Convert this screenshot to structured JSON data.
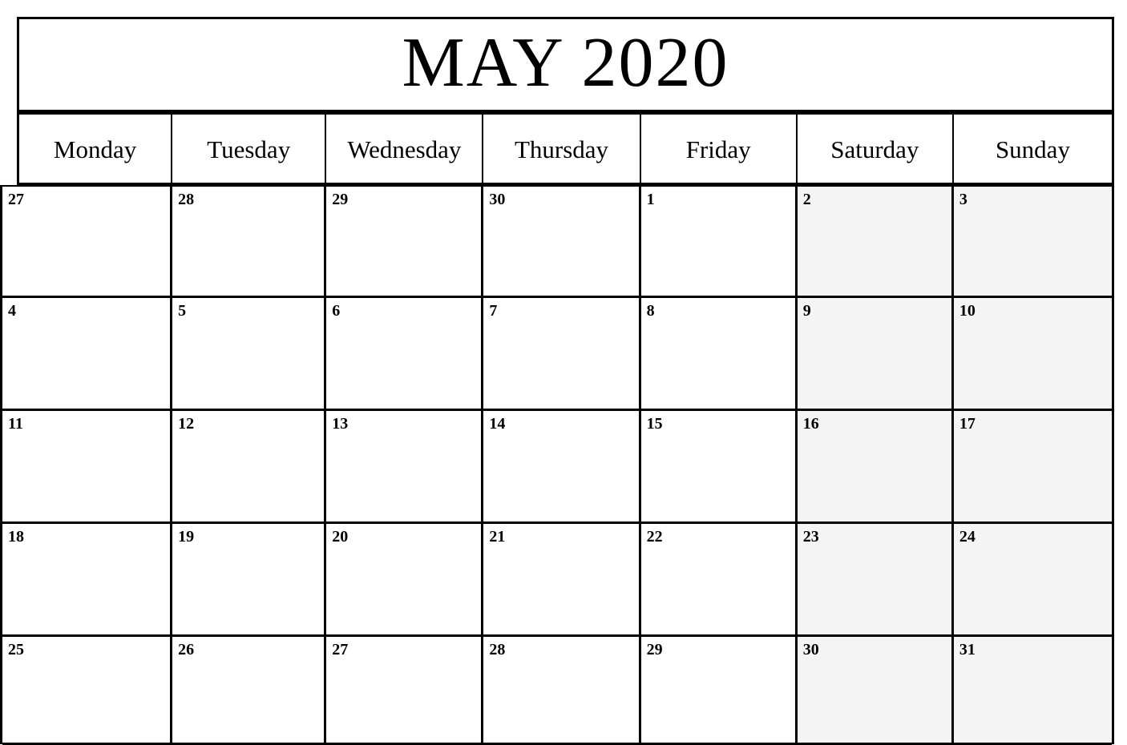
{
  "calendar": {
    "title": "MAY 2020",
    "month": "MAY",
    "year": "2020",
    "colors": {
      "border": "#000000",
      "page_background": "#ffffff",
      "cell_background": "#ffffff",
      "weekend_background": "#f4f4f4",
      "text": "#000000"
    },
    "weekdays": [
      {
        "label": "Monday",
        "weekend": false
      },
      {
        "label": "Tuesday",
        "weekend": false
      },
      {
        "label": "Wednesday",
        "weekend": false
      },
      {
        "label": "Thursday",
        "weekend": false
      },
      {
        "label": "Friday",
        "weekend": false
      },
      {
        "label": "Saturday",
        "weekend": true
      },
      {
        "label": "Sunday",
        "weekend": true
      }
    ],
    "weeks": [
      {
        "days": [
          {
            "number": "27",
            "weekend": false,
            "other_month": true
          },
          {
            "number": "28",
            "weekend": false,
            "other_month": true
          },
          {
            "number": "29",
            "weekend": false,
            "other_month": true
          },
          {
            "number": "30",
            "weekend": false,
            "other_month": true
          },
          {
            "number": "1",
            "weekend": false,
            "other_month": false
          },
          {
            "number": "2",
            "weekend": true,
            "other_month": false
          },
          {
            "number": "3",
            "weekend": true,
            "other_month": false
          }
        ]
      },
      {
        "days": [
          {
            "number": "4",
            "weekend": false,
            "other_month": false
          },
          {
            "number": "5",
            "weekend": false,
            "other_month": false
          },
          {
            "number": "6",
            "weekend": false,
            "other_month": false
          },
          {
            "number": "7",
            "weekend": false,
            "other_month": false
          },
          {
            "number": "8",
            "weekend": false,
            "other_month": false
          },
          {
            "number": "9",
            "weekend": true,
            "other_month": false
          },
          {
            "number": "10",
            "weekend": true,
            "other_month": false
          }
        ]
      },
      {
        "days": [
          {
            "number": "11",
            "weekend": false,
            "other_month": false
          },
          {
            "number": "12",
            "weekend": false,
            "other_month": false
          },
          {
            "number": "13",
            "weekend": false,
            "other_month": false
          },
          {
            "number": "14",
            "weekend": false,
            "other_month": false
          },
          {
            "number": "15",
            "weekend": false,
            "other_month": false
          },
          {
            "number": "16",
            "weekend": true,
            "other_month": false
          },
          {
            "number": "17",
            "weekend": true,
            "other_month": false
          }
        ]
      },
      {
        "days": [
          {
            "number": "18",
            "weekend": false,
            "other_month": false
          },
          {
            "number": "19",
            "weekend": false,
            "other_month": false
          },
          {
            "number": "20",
            "weekend": false,
            "other_month": false
          },
          {
            "number": "21",
            "weekend": false,
            "other_month": false
          },
          {
            "number": "22",
            "weekend": false,
            "other_month": false
          },
          {
            "number": "23",
            "weekend": true,
            "other_month": false
          },
          {
            "number": "24",
            "weekend": true,
            "other_month": false
          }
        ]
      },
      {
        "days": [
          {
            "number": "25",
            "weekend": false,
            "other_month": false
          },
          {
            "number": "26",
            "weekend": false,
            "other_month": false
          },
          {
            "number": "27",
            "weekend": false,
            "other_month": false
          },
          {
            "number": "28",
            "weekend": false,
            "other_month": false
          },
          {
            "number": "29",
            "weekend": false,
            "other_month": false
          },
          {
            "number": "30",
            "weekend": true,
            "other_month": false
          },
          {
            "number": "31",
            "weekend": true,
            "other_month": false
          }
        ]
      }
    ]
  }
}
